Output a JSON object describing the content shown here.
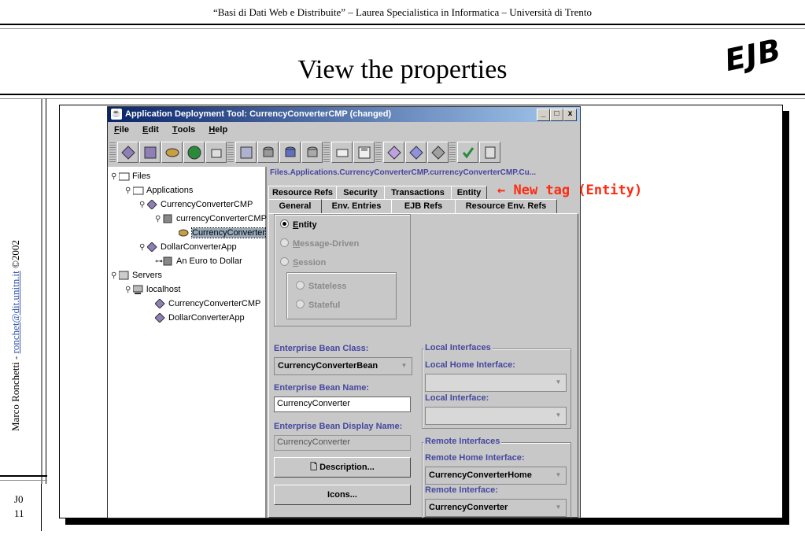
{
  "slide": {
    "header": "“Basi di Dati Web e Distribuite” – Laurea Specialistica in Informatica – Università di Trento",
    "title": "View the properties",
    "logo": "EJB",
    "author": "Marco Ronchetti",
    "author_sep": " - ",
    "author_email": "ronchet@dit.unitn.it",
    "copyright": "©2002",
    "slide_code": "J0",
    "slide_number": "11"
  },
  "window": {
    "title": "Application Deployment Tool: CurrencyConverterCMP (changed)",
    "min": "_",
    "max": "□",
    "close": "x"
  },
  "menu": {
    "file_k": "F",
    "file": "ile",
    "edit_k": "E",
    "edit": "dit",
    "tools_k": "T",
    "tools": "ools",
    "help_k": "H",
    "help": "elp"
  },
  "tree": {
    "files": "Files",
    "applications": "Applications",
    "app1": "CurrencyConverterCMP",
    "jar1": "currencyConverterCMP",
    "bean1": "CurrencyConverter",
    "app2": "DollarConverterApp",
    "jar2": "An Euro to Dollar",
    "servers": "Servers",
    "localhost": "localhost",
    "srv_app1": "CurrencyConverterCMP",
    "srv_app2": "DollarConverterApp"
  },
  "panel": {
    "path": "Files.Applications.CurrencyConverterCMP.currencyConverterCMP.Cu...",
    "tabs_row1": [
      "Resource Refs",
      "Security",
      "Transactions",
      "Entity"
    ],
    "tabs_row2": [
      "General",
      "Env. Entries",
      "EJB Refs",
      "Resource Env. Refs"
    ],
    "bean_type": {
      "entity_k": "E",
      "entity": "ntity",
      "message_k": "M",
      "message": "essage-Driven",
      "session_k": "S",
      "session": "ession",
      "stateless": "Stateless",
      "stateful": "Stateful"
    },
    "bean_class_label": "Enterprise Bean Class:",
    "bean_class_value": "CurrencyConverterBean",
    "bean_name_label": "Enterprise Bean Name:",
    "bean_name_value": "CurrencyConverter",
    "display_name_label": "Enterprise Bean Display Name:",
    "display_name_value": "CurrencyConverter",
    "description_button": "Description...",
    "icons_button": "Icons...",
    "local_group": "Local Interfaces",
    "local_home_label": "Local Home Interface:",
    "local_label": "Local Interface:",
    "remote_group": "Remote Interfaces",
    "remote_home_label": "Remote Home Interface:",
    "remote_home_value": "CurrencyConverterHome",
    "remote_label": "Remote Interface:",
    "remote_value": "CurrencyConverter"
  },
  "annotation": "← New tag (Entity)",
  "colors": {
    "title_bar_start": "#0a246a",
    "title_bar_end": "#a6caf0",
    "label_blue": "#4646a0",
    "annotation_red": "#ff2a10"
  }
}
